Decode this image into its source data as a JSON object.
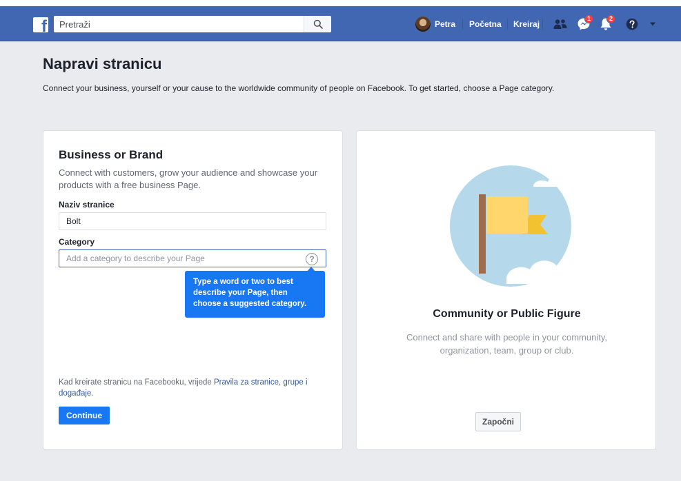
{
  "topbar": {
    "logo_letter": "f",
    "search_placeholder": "Pretraži",
    "profile_name": "Petra",
    "home_label": "Početna",
    "create_label": "Kreiraj",
    "messages_badge": "1",
    "notifications_badge": "2",
    "icons": [
      "facebook-logo-icon",
      "search-icon",
      "friends-icon",
      "messenger-icon",
      "bell-icon",
      "help-icon",
      "caret-down-icon"
    ],
    "brand_color": "#4267b2"
  },
  "page": {
    "title": "Napravi stranicu",
    "subtitle": "Connect your business, yourself or your cause to the worldwide community of people on Facebook. To get started, choose a Page category."
  },
  "business_card": {
    "heading": "Business or Brand",
    "description": "Connect with customers, grow your audience and showcase your products with a free business Page.",
    "page_name_label": "Naziv stranice",
    "page_name_value": "Bolt",
    "category_label": "Category",
    "category_placeholder": "Add a category to describe your Page",
    "category_help_glyph": "?",
    "tooltip": "Type a word or two to best describe your Page, then choose a suggested category.",
    "policy_prefix": "Kad kreirate stranicu na Facebooku, vrijede ",
    "policy_link": "Pravila za stranice, grupe i događaje",
    "policy_suffix": ".",
    "continue_label": "Continue",
    "accent_color": "#1877f2"
  },
  "community_card": {
    "heading": "Community or Public Figure",
    "description": "Connect and share with people in your community, organization, team, group or club.",
    "start_label": "Započni",
    "illustration_icon": "flag-illustration-icon"
  }
}
